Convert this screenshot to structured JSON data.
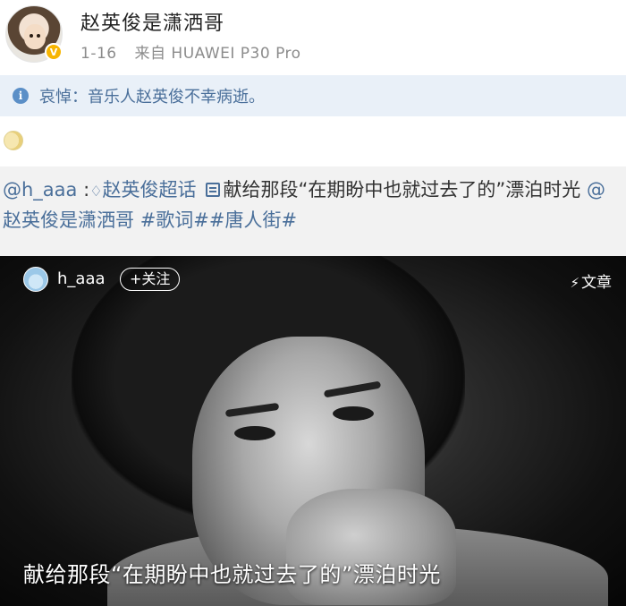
{
  "post": {
    "author": "赵英俊是潇洒哥",
    "time": "1-16",
    "source_prefix": "来自",
    "device": "HUAWEI P30 Pro",
    "notice": "哀悼：音乐人赵英俊不幸病逝。"
  },
  "repost": {
    "user_mention": "@h_aaa",
    "colon": " :",
    "topic_icon": "diamond-icon",
    "topic": "赵英俊超话",
    "doc_icon": "document-icon",
    "text": "献给那段“在期盼中也就过去了的”漂泊时光",
    "mention": "@赵英俊是潇洒哥",
    "hashtags": "#歌词##唐人街#"
  },
  "card": {
    "username": "h_aaa",
    "follow_label": "+关注",
    "article_label": "文章",
    "caption": "献给那段“在期盼中也就过去了的”漂泊时光"
  },
  "colors": {
    "link": "#4a6f9a",
    "notice_bg": "#e9f0f8",
    "repost_bg": "#f2f2f2",
    "verified_badge": "#f7b500"
  }
}
